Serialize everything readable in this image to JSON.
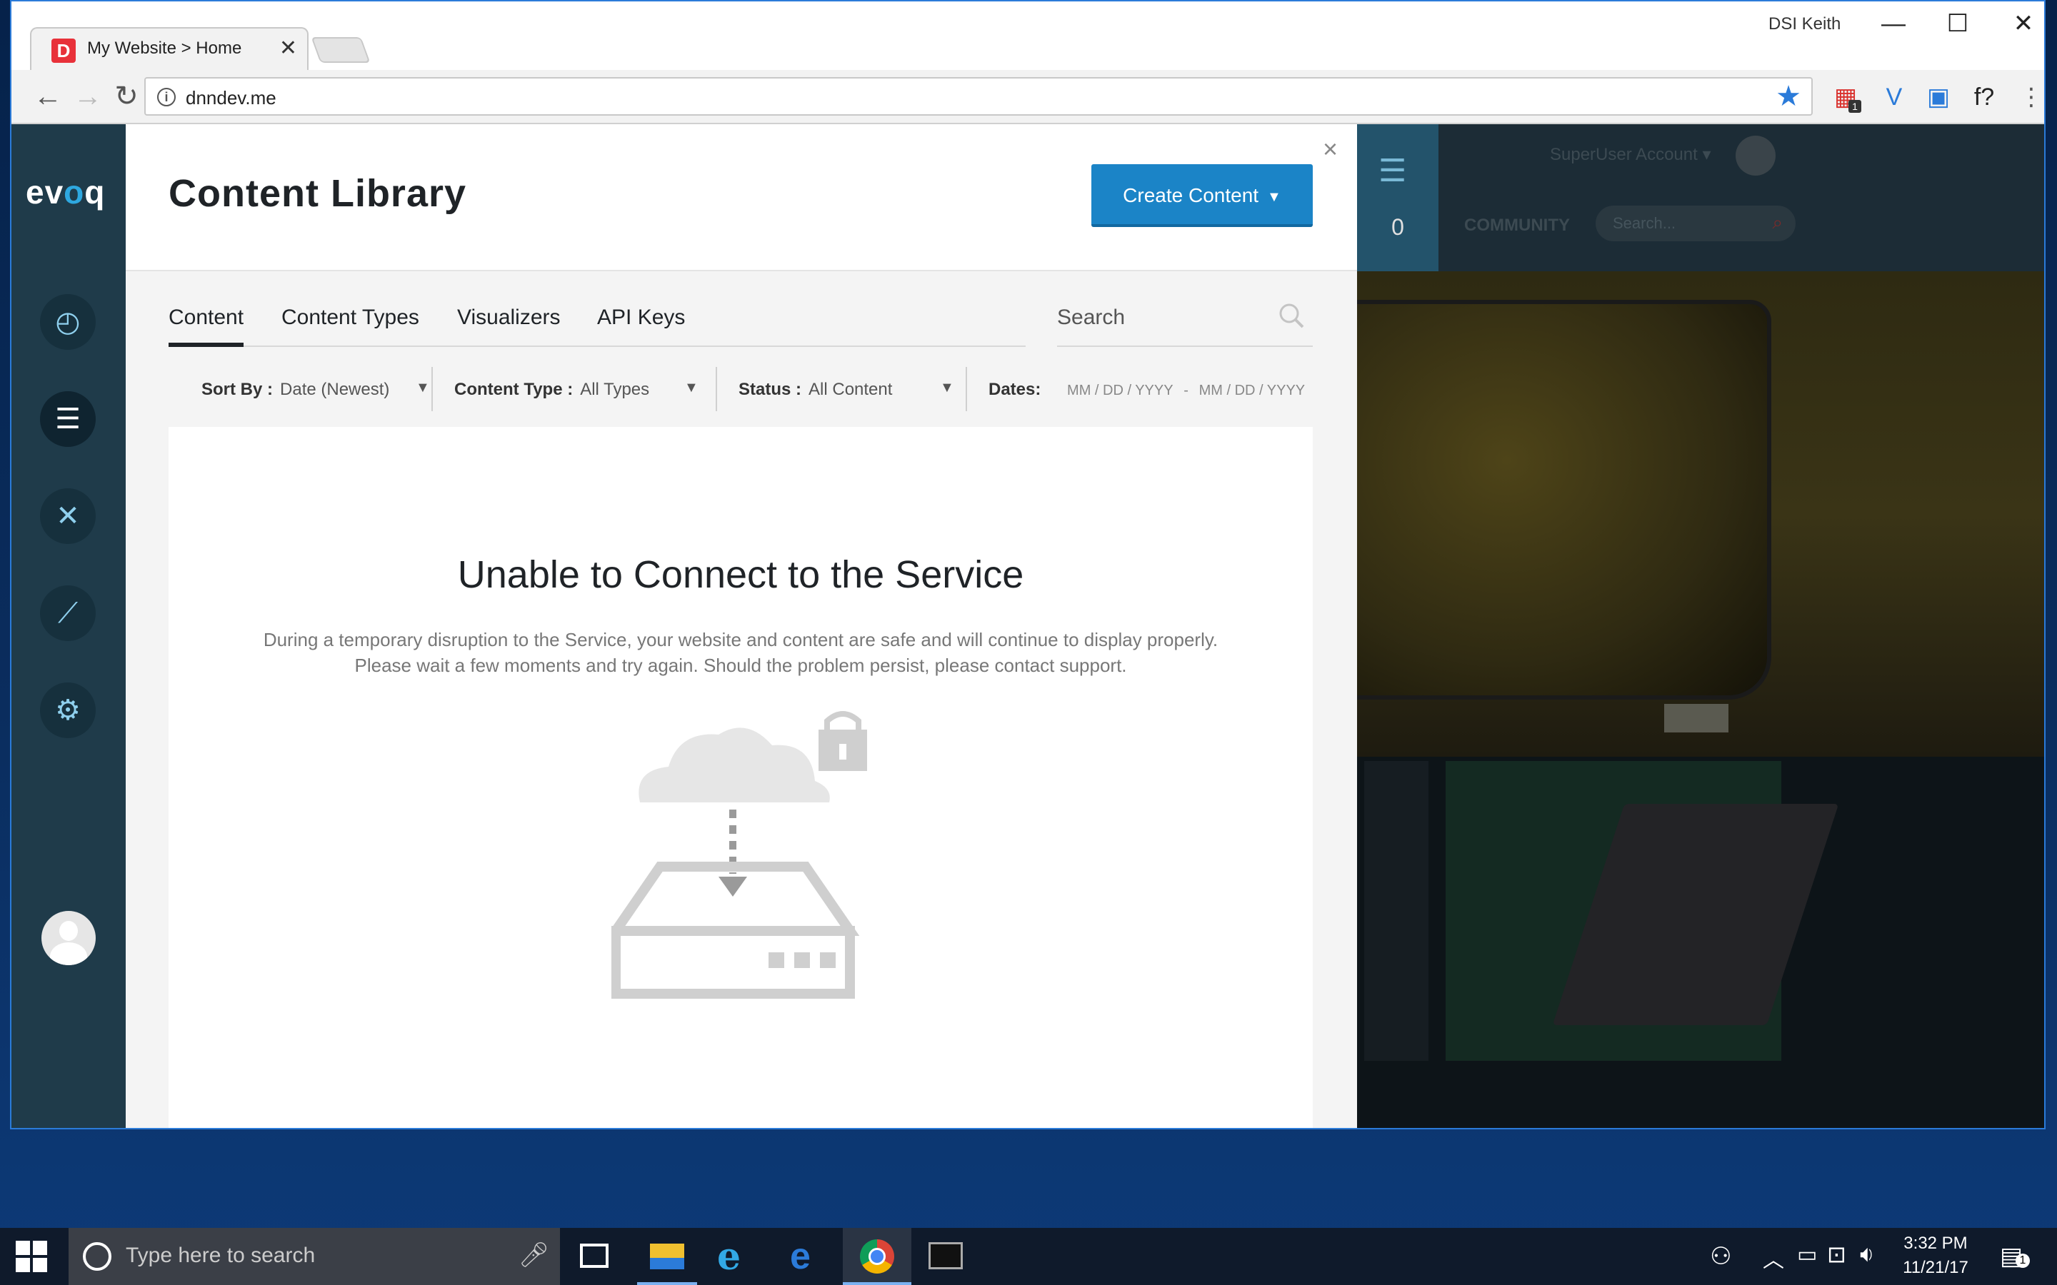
{
  "browser": {
    "tab_title": "My Website > Home",
    "tab_close": "✕",
    "user": "DSI Keith",
    "url": "dnndev.me",
    "window_buttons": {
      "minimize": "—",
      "maximize": "☐",
      "close": "✕"
    },
    "extensions": [
      {
        "name": "calendar-extension-icon",
        "glyph": "▦",
        "color": "#d9302c",
        "badge": "1"
      },
      {
        "name": "vimeo-extension-icon",
        "glyph": "V",
        "color": "#2b7bd9"
      },
      {
        "name": "screenshot-extension-icon",
        "glyph": "▣",
        "color": "#2b7bd9"
      },
      {
        "name": "font-extension-icon",
        "glyph": "f?",
        "color": "#222222"
      },
      {
        "name": "menu-icon",
        "glyph": "⋮",
        "color": "#555555"
      }
    ]
  },
  "evoq": {
    "logo_text_a": "ev",
    "logo_text_o": "o",
    "logo_text_b": "q",
    "sidebar_icons": [
      {
        "name": "dashboard-icon",
        "glyph": "◴",
        "active": false
      },
      {
        "name": "content-icon",
        "glyph": "☰",
        "active": true
      },
      {
        "name": "tools-icon",
        "glyph": "✕",
        "active": false
      },
      {
        "name": "analytics-icon",
        "glyph": "⟋",
        "active": false
      },
      {
        "name": "settings-icon",
        "glyph": "⚙",
        "active": false
      }
    ]
  },
  "site": {
    "notification_count": "0",
    "account": "SuperUser Account ▾",
    "community": "COMMUNITY",
    "search_placeholder": "Search..."
  },
  "modal": {
    "title": "Content Library",
    "create_button": "Create Content",
    "close": "×",
    "tabs": [
      {
        "label": "Content",
        "active": true
      },
      {
        "label": "Content Types",
        "active": false
      },
      {
        "label": "Visualizers",
        "active": false
      },
      {
        "label": "API Keys",
        "active": false
      }
    ],
    "search_label": "Search",
    "filters": {
      "sort_label": "Sort By :",
      "sort_value": "Date (Newest)",
      "type_label": "Content Type :",
      "type_value": "All Types",
      "status_label": "Status :",
      "status_value": "All Content",
      "dates_label": "Dates:",
      "date_from": "MM / DD / YYYY",
      "date_sep": "-",
      "date_to": "MM / DD / YYYY"
    },
    "error_title": "Unable to Connect to the Service",
    "error_message": "During a temporary disruption to the Service, your website and content are safe and will continue to display properly. Please wait a few moments and try again. Should the problem persist, please contact support."
  },
  "taskbar": {
    "search_placeholder": "Type here to search",
    "time": "3:32 PM",
    "date": "11/21/17",
    "notification_badge": "1"
  },
  "colors": {
    "accent": "#1b84c7",
    "sidebar": "#1f3b4a",
    "taskbar": "#0f1a2b"
  }
}
